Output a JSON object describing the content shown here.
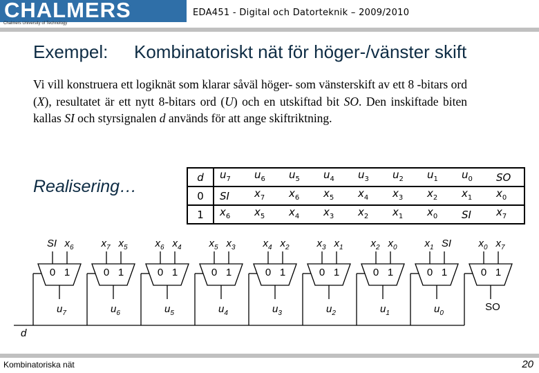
{
  "header": {
    "logo_text": "CHALMERS",
    "logo_subtitle": "Chalmers University of Technology",
    "course_title": "EDA451 - Digital och Datorteknik – 2009/2010",
    "colors": {
      "logo_bg": "#2f6fa8",
      "bar": "#c0c0c0",
      "title_text": "#0e2c44"
    }
  },
  "slide": {
    "title_label": "Exempel:",
    "title_main": "Kombinatoriskt nät för höger-/vänster skift",
    "intro": {
      "p1": "Vi vill konstruera ett logiknät som klarar såväl höger- som vänsterskift av ett 8 -bitars ord (",
      "var_X": "X",
      "p2": "), resultatet är ett nytt 8-bitars ord (",
      "var_U": "U",
      "p3": ") och en utskiftad bit ",
      "var_SO": "SO",
      "p4": ". Den inskiftade biten kallas ",
      "var_SI": "SI",
      "p5": " och styrsignalen ",
      "var_d": "d",
      "p6": " används för att ange skiftriktning."
    },
    "realisering": "Realisering…"
  },
  "truth_table": {
    "header": {
      "d": "d",
      "cols": [
        {
          "base": "u",
          "sub": "7"
        },
        {
          "base": "u",
          "sub": "6"
        },
        {
          "base": "u",
          "sub": "5"
        },
        {
          "base": "u",
          "sub": "4"
        },
        {
          "base": "u",
          "sub": "3"
        },
        {
          "base": "u",
          "sub": "2"
        },
        {
          "base": "u",
          "sub": "1"
        },
        {
          "base": "u",
          "sub": "0"
        },
        {
          "base": "SO",
          "sub": ""
        }
      ]
    },
    "rows": [
      {
        "d": "0",
        "cols": [
          {
            "base": "SI",
            "sub": ""
          },
          {
            "base": "x",
            "sub": "7"
          },
          {
            "base": "x",
            "sub": "6"
          },
          {
            "base": "x",
            "sub": "5"
          },
          {
            "base": "x",
            "sub": "4"
          },
          {
            "base": "x",
            "sub": "3"
          },
          {
            "base": "x",
            "sub": "2"
          },
          {
            "base": "x",
            "sub": "1"
          },
          {
            "base": "x",
            "sub": "0"
          }
        ]
      },
      {
        "d": "1",
        "cols": [
          {
            "base": "x",
            "sub": "6"
          },
          {
            "base": "x",
            "sub": "5"
          },
          {
            "base": "x",
            "sub": "4"
          },
          {
            "base": "x",
            "sub": "3"
          },
          {
            "base": "x",
            "sub": "2"
          },
          {
            "base": "x",
            "sub": "1"
          },
          {
            "base": "x",
            "sub": "0"
          },
          {
            "base": "SI",
            "sub": ""
          },
          {
            "base": "x",
            "sub": "7"
          }
        ]
      }
    ]
  },
  "circuit": {
    "control_signal": "d",
    "select_labels": [
      "0",
      "1"
    ],
    "muxes": [
      {
        "in0": {
          "base": "SI",
          "sub": ""
        },
        "in1": {
          "base": "x",
          "sub": "6"
        },
        "out": {
          "base": "u",
          "sub": "7"
        }
      },
      {
        "in0": {
          "base": "x",
          "sub": "7"
        },
        "in1": {
          "base": "x",
          "sub": "5"
        },
        "out": {
          "base": "u",
          "sub": "6"
        }
      },
      {
        "in0": {
          "base": "x",
          "sub": "6"
        },
        "in1": {
          "base": "x",
          "sub": "4"
        },
        "out": {
          "base": "u",
          "sub": "5"
        }
      },
      {
        "in0": {
          "base": "x",
          "sub": "5"
        },
        "in1": {
          "base": "x",
          "sub": "3"
        },
        "out": {
          "base": "u",
          "sub": "4"
        }
      },
      {
        "in0": {
          "base": "x",
          "sub": "4"
        },
        "in1": {
          "base": "x",
          "sub": "2"
        },
        "out": {
          "base": "u",
          "sub": "3"
        }
      },
      {
        "in0": {
          "base": "x",
          "sub": "3"
        },
        "in1": {
          "base": "x",
          "sub": "1"
        },
        "out": {
          "base": "u",
          "sub": "2"
        }
      },
      {
        "in0": {
          "base": "x",
          "sub": "2"
        },
        "in1": {
          "base": "x",
          "sub": "0"
        },
        "out": {
          "base": "u",
          "sub": "1"
        }
      },
      {
        "in0": {
          "base": "x",
          "sub": "1"
        },
        "in1": {
          "base": "SI",
          "sub": ""
        },
        "out": {
          "base": "u",
          "sub": "0"
        }
      },
      {
        "in0": {
          "base": "x",
          "sub": "0"
        },
        "in1": {
          "base": "x",
          "sub": "7"
        },
        "out": {
          "base": "SO",
          "sub": "",
          "upright": true
        }
      }
    ]
  },
  "footer": {
    "left": "Kombinatoriska nät",
    "page_number": "20"
  }
}
